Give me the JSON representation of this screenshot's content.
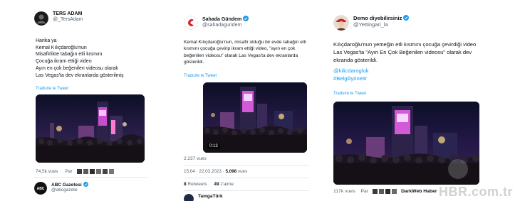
{
  "tweet1": {
    "display_name": "TERS ADAM",
    "handle": "@_TersAdam",
    "text": "Harika ya\nKemal Kılıçdaroğlu'nun\nMisafirlikte tabağın etli kısmını\nÇocuğa ikram ettiği video\nAyın en çok beğenilen videosu olarak\nLas Vegas'ta dev ekranlarda gösterilmiş",
    "translate": "Traduire le Tweet",
    "views": "74,5k vues",
    "replies_label": "Par",
    "next_account": {
      "display_name": "ABC Gazetesi",
      "handle": "@abcgazete"
    }
  },
  "tweet2": {
    "display_name": "Sahada Gündem",
    "handle": "@sahadagundem",
    "text": "Kemal Kılıçdaroğlu'nun, misafir olduğu bir evde tabağın etli kısmını çocuğa çevirip ikram ettiği video, \"ayın en çok beğenilen videosu\" olarak Las Vegas'ta dev ekranlarda gösterildi.",
    "translate": "Traduire le Tweet",
    "video_time": "0:13",
    "views": "2.237 vues",
    "date": "15:04 · 22.03.2023 · ",
    "date_views": "5.096",
    "date_views_label": " vues",
    "retweets": "8",
    "retweets_label": " Retweets",
    "likes": "49",
    "likes_label": " J'aime",
    "next_account": "TamgaTürk"
  },
  "tweet3": {
    "display_name": "Demo diyebilirsiniz",
    "handle": "@Yettingari_la",
    "text": "Kılıçdaroğlu'nun yemeğin etli kısmını çocuğa çevirdiği video Las Vegas'ta \"Ayın En Çok Beğenilen videosu\" olarak dev ekranda gösterildi.",
    "hashtag1": "@kilicdarogluk",
    "hashtag2": "#Belgiliyönetir",
    "translate": "Traduire le Tweet",
    "views": "117k vues",
    "replies_label": "Par",
    "by_account": "DarkWeb Haber"
  },
  "watermark": "HBR.com.tr",
  "colors": {
    "link": "#1d9bf0",
    "verified": "#1d9bf0",
    "muted": "#536471"
  }
}
